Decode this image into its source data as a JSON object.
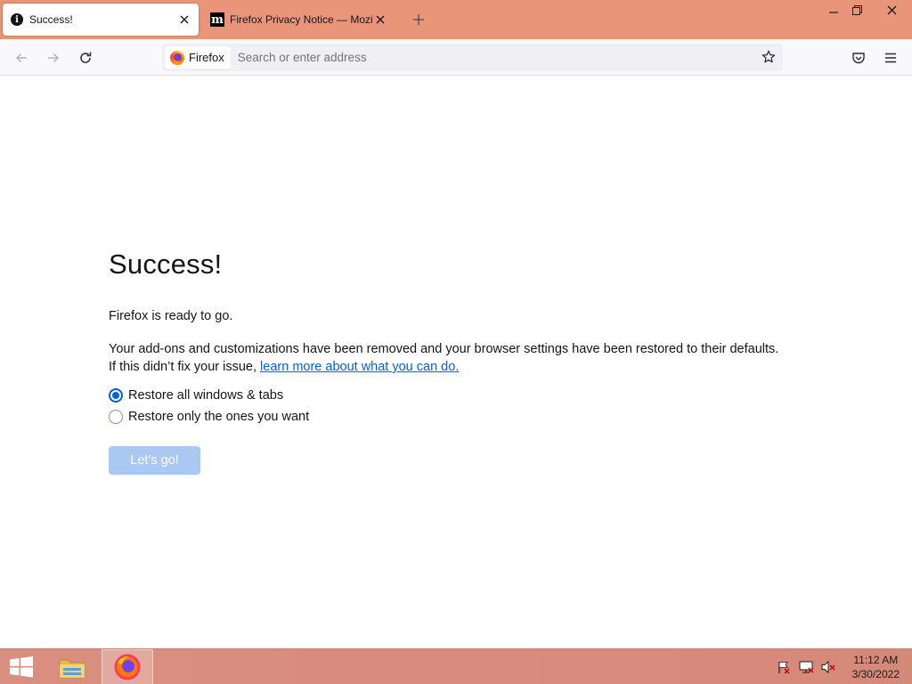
{
  "browser": {
    "tabs": [
      {
        "title": "Success!",
        "icon": "info-icon",
        "active": true
      },
      {
        "title": "Firefox Privacy Notice — Mozilla",
        "icon": "mozilla-m-icon",
        "active": false
      }
    ],
    "identity_label": "Firefox",
    "url_placeholder": "Search or enter address"
  },
  "page": {
    "heading": "Success!",
    "ready_text": "Firefox is ready to go.",
    "removed_text": "Your add-ons and customizations have been removed and your browser settings have been restored to their defaults.",
    "fix_text": "If this didn’t fix your issue, ",
    "learn_more_link": "learn more about what you can do.",
    "radio_options": [
      {
        "label": "Restore all windows & tabs",
        "checked": true
      },
      {
        "label": "Restore only the ones you want",
        "checked": false
      }
    ],
    "button_label": "Let’s go!"
  },
  "taskbar": {
    "time": "11:12 AM",
    "date": "3/30/2022"
  },
  "colors": {
    "tabstrip": "#e8957a",
    "link": "#0060df",
    "button": "#a9c8f2",
    "taskbar": "#d9897c"
  }
}
